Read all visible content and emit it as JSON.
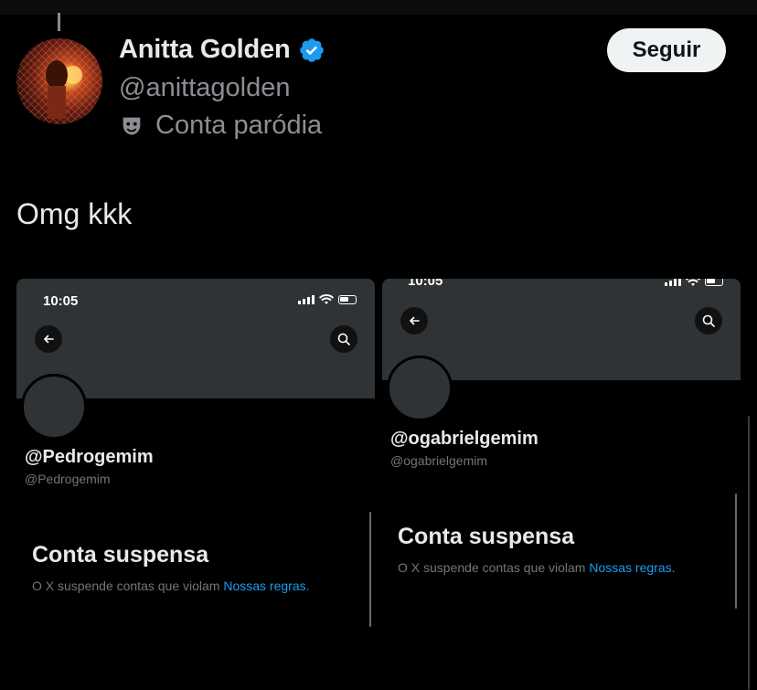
{
  "post": {
    "author": {
      "display_name": "Anitta Golden",
      "handle": "@anittagolden",
      "label": "Conta paródia",
      "verified_icon": "verified-badge-icon",
      "label_icon": "theater-mask-icon"
    },
    "follow_label": "Seguir",
    "text": "Omg kkk"
  },
  "screenshots": [
    {
      "time": "10:05",
      "username": "@Pedrogemim",
      "handle": "@Pedrogemim",
      "suspended_title": "Conta suspensa",
      "suspended_text": "O X suspende contas que violam ",
      "rules_link": "Nossas regras",
      "rules_suffix": "."
    },
    {
      "time": "10:05",
      "username": "@ogabrielgemim",
      "handle": "@ogabrielgemim",
      "suspended_title": "Conta suspensa",
      "suspended_text": "O X suspende contas que violam ",
      "rules_link": "Nossas regras",
      "rules_suffix": "."
    }
  ],
  "colors": {
    "background": "#000000",
    "verified": "#1d9bf0",
    "link": "#1d9bf0",
    "banner": "#2f3336"
  }
}
